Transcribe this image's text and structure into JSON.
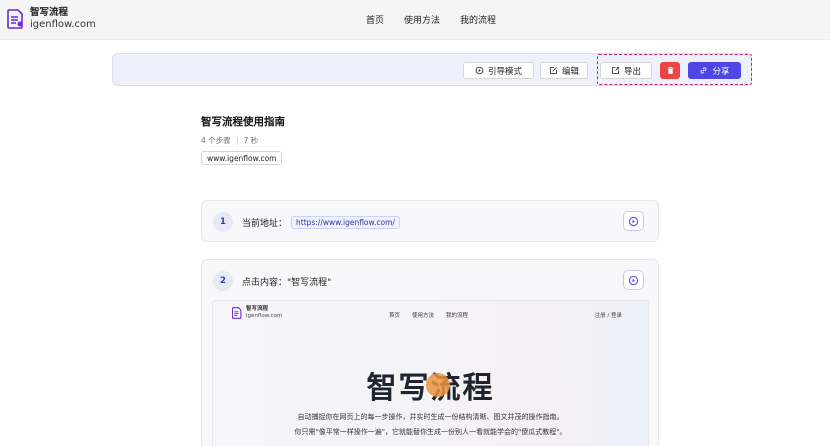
{
  "app": {
    "name": "智写流程",
    "domain": "igenflow.com"
  },
  "nav": {
    "items": [
      "首页",
      "使用方法",
      "我的流程"
    ]
  },
  "toolbar": {
    "guide_label": "引导模式",
    "edit_label": "编辑",
    "export_label": "导出",
    "share_label": "分享"
  },
  "guide": {
    "title": "智写流程使用指南",
    "steps_count": "4 个步骤",
    "duration": "7 秒",
    "domain_tag": "www.igenflow.com"
  },
  "steps": [
    {
      "number": "1",
      "label": "当前地址：",
      "url": "https://www.igenflow.com/"
    },
    {
      "number": "2",
      "label": "点击内容：\"智写流程\""
    }
  ],
  "screenshot": {
    "logo_name": "智写流程",
    "logo_domain": "igenflow.com",
    "nav": [
      "首页",
      "使用方法",
      "我的流程"
    ],
    "login": "注册 / 登录",
    "hero": "智写流程",
    "desc1": "自动捕捉你在网页上的每一步操作，并实时生成一份结构清晰、图文并茂的操作指南。",
    "desc2": "你只需\"像平常一样操作一遍\"，它就能替你生成一份别人一看就能学会的\"傻瓜式教程\"。"
  },
  "colors": {
    "accent": "#4f46e5",
    "danger": "#ef4444",
    "highlight": "#c0266e"
  }
}
